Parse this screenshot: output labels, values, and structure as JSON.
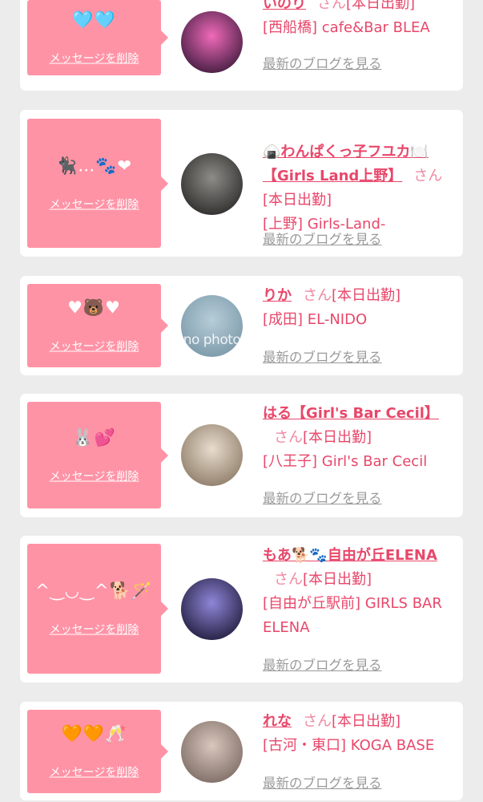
{
  "delete_label": "メッセージを削除",
  "blog_label": "最新のブログを見る",
  "san_label": "さん",
  "items": [
    {
      "emoji": "🩵🩵",
      "name": "いのり",
      "status": "[本日出勤]",
      "shop": "[西船橋] cafe&Bar BLEA",
      "avatar_colors": [
        "#f06ab9",
        "#3d1a3c"
      ]
    },
    {
      "emoji": "🐈‍⬛…🐾❤",
      "name": "🍙わんぱくっ子フユカ🍽️【Girls Land上野】",
      "status": "[本日出勤]",
      "shop": "[上野] Girls-Land-",
      "avatar_colors": [
        "#8e8c88",
        "#2b2a28"
      ]
    },
    {
      "emoji": "♥🐻♥",
      "name": "りか",
      "status": "[本日出勤]",
      "shop": "[成田] EL-NIDO",
      "avatar_colors": [
        "#b7cdd8",
        "#7a98a8"
      ],
      "avatar_text": "no photo"
    },
    {
      "emoji": "🐰💕",
      "name": "はる【Girl's Bar Cecil】",
      "status": "[本日出勤]",
      "shop": "[八王子] Girl's Bar Cecil",
      "avatar_colors": [
        "#e8dccd",
        "#8c7a66"
      ]
    },
    {
      "emoji": "^‿◡‿^🐕🪄",
      "name": "もあ🐕🐾自由が丘ELENA",
      "status": "[本日出勤]",
      "shop": "[自由が丘駅前] GIRLS BAR ELENA",
      "avatar_colors": [
        "#8e86d8",
        "#1f1b3a"
      ]
    },
    {
      "emoji": "🧡🧡🥂",
      "name": "れな",
      "status": "[本日出勤]",
      "shop": "[古河・東口] KOGA BASE",
      "avatar_colors": [
        "#d9c7bd",
        "#7b6a63"
      ]
    }
  ]
}
